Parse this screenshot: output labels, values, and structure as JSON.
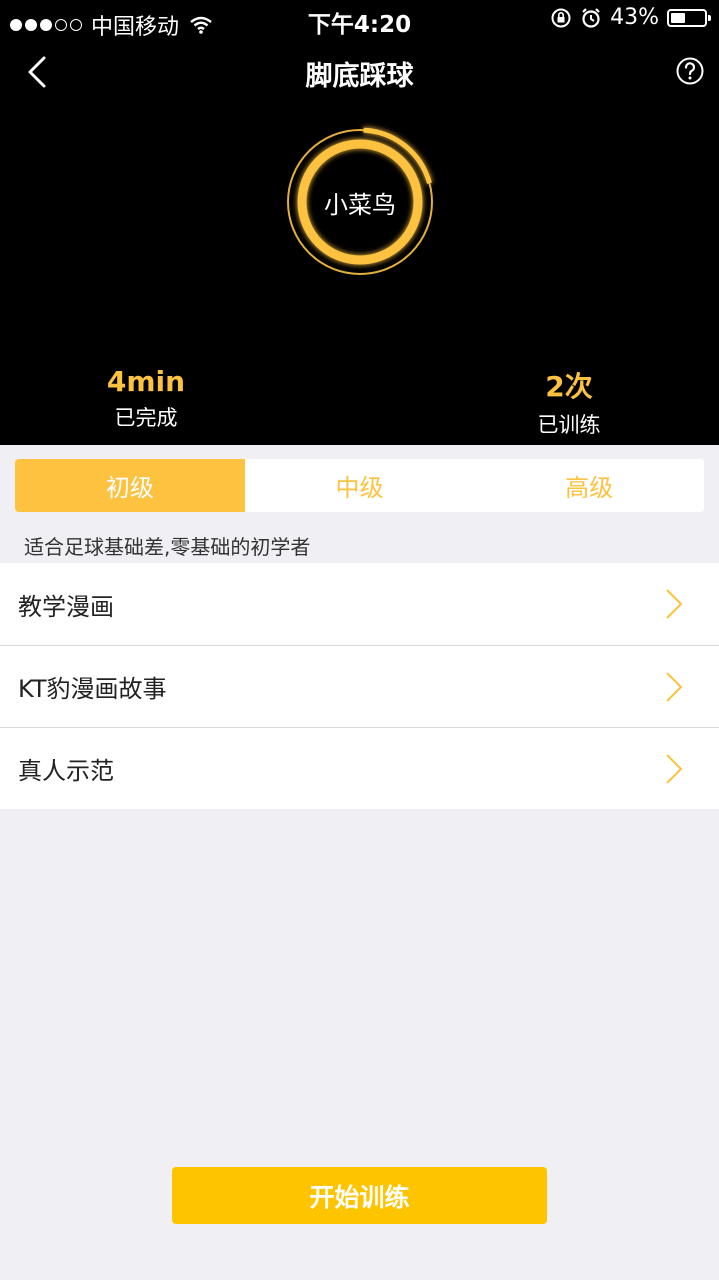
{
  "status_bar": {
    "carrier": "中国移动",
    "time": "下午4:20",
    "battery_text": "43%",
    "battery_level": 0.43,
    "signal_bars_filled": 3,
    "signal_bars_total": 5
  },
  "nav": {
    "title": "脚底踩球",
    "back_icon": "chevron-left-icon",
    "help_icon": "question-circle-icon"
  },
  "level_ring": {
    "label": "小菜鸟",
    "progress": 0.2,
    "accent": "#fdc240"
  },
  "stats": {
    "completed_value": "4min",
    "completed_label": "已完成",
    "trained_value": "2次",
    "trained_label": "已训练"
  },
  "tabs": [
    {
      "label": "初级",
      "active": true
    },
    {
      "label": "中级",
      "active": false
    },
    {
      "label": "高级",
      "active": false
    }
  ],
  "description": "适合足球基础差,零基础的初学者",
  "list_items": [
    {
      "label": "教学漫画"
    },
    {
      "label": "KT豹漫画故事"
    },
    {
      "label": "真人示范"
    }
  ],
  "start_button": "开始训练",
  "colors": {
    "accent": "#fdc240",
    "button": "#fec400",
    "header_bg": "#000000",
    "page_bg": "#efeff4"
  }
}
